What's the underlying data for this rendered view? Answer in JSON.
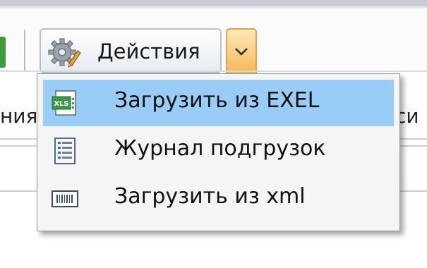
{
  "toolbar": {
    "actions_label": "Действия",
    "actions_icon": "gear-icon",
    "dropdown_icon": "chevron-down-icon"
  },
  "background": {
    "left_fragment": "ния",
    "right_fragment": "си"
  },
  "menu": {
    "items": [
      {
        "label": "Загрузить из EXEL",
        "icon": "xls-file-icon",
        "selected": true
      },
      {
        "label": "Журнал подгрузок",
        "icon": "journal-icon",
        "selected": false
      },
      {
        "label": "Загрузить из xml",
        "icon": "xml-barcode-icon",
        "selected": false
      }
    ]
  },
  "colors": {
    "selection": "#99ccf7",
    "dropdown_accent": "#f6b451",
    "xls_green": "#3a9a48"
  }
}
